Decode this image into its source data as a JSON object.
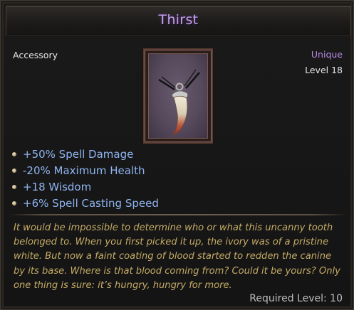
{
  "item": {
    "title": "Thirst",
    "type": "Accessory",
    "rarity": "Unique",
    "level": "Level 18",
    "icon": "fang-pendant-icon"
  },
  "stats": [
    "+50% Spell Damage",
    "-20% Maximum Health",
    "+18 Wisdom",
    "+6% Spell Casting Speed"
  ],
  "flavor": {
    "lines": [
      "It would be impossible to determine who or what this uncanny tooth",
      "belonged to. When you first picked it up, the ivory was of a pristine",
      "white. But now a faint coating of blood started to redden the canine",
      "by its base. Where is that blood coming from? Could it be yours? Only",
      "one thing is sure: it’s hungry, hungry for more."
    ]
  },
  "requirement": "Required Level: 10",
  "colors": {
    "title": "#c9a3f0",
    "rarity": "#b78be6",
    "stat": "#8fb4f0",
    "flavor": "#c5ab66"
  }
}
